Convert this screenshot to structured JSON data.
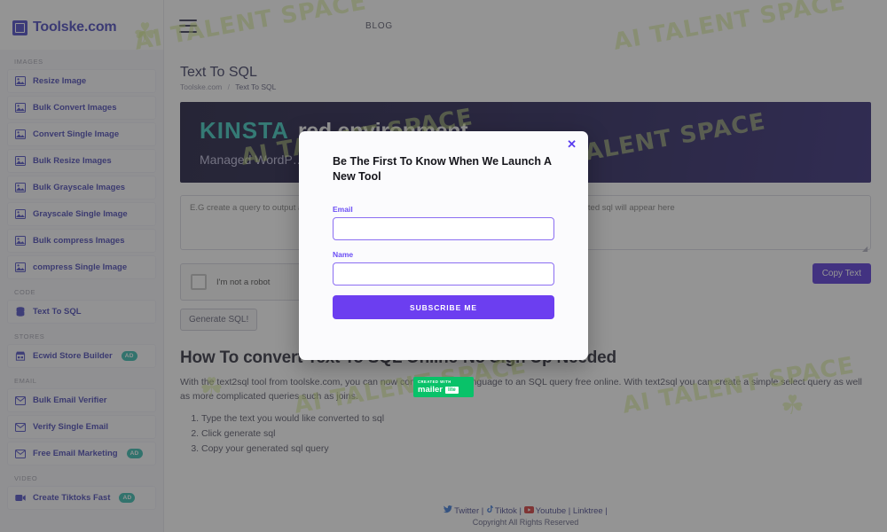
{
  "brand": {
    "name": "Toolske.com",
    "logo_icon": "grid-logo-icon"
  },
  "topnav": {
    "menu_icon": "hamburger-menu-icon",
    "blog_label": "BLOG"
  },
  "sidebar": {
    "groups": [
      {
        "label": "IMAGES",
        "items": [
          {
            "label": "Resize Image",
            "icon": "image-icon",
            "ad": ""
          },
          {
            "label": "Bulk Convert Images",
            "icon": "image-icon",
            "ad": ""
          },
          {
            "label": "Convert Single Image",
            "icon": "image-icon",
            "ad": ""
          },
          {
            "label": "Bulk Resize Images",
            "icon": "image-icon",
            "ad": ""
          },
          {
            "label": "Bulk Grayscale Images",
            "icon": "image-icon",
            "ad": ""
          },
          {
            "label": "Grayscale Single Image",
            "icon": "image-icon",
            "ad": ""
          },
          {
            "label": "Bulk compress Images",
            "icon": "image-icon",
            "ad": ""
          },
          {
            "label": "compress Single Image",
            "icon": "image-icon",
            "ad": ""
          }
        ]
      },
      {
        "label": "CODE",
        "items": [
          {
            "label": "Text To SQL",
            "icon": "database-icon",
            "ad": ""
          }
        ]
      },
      {
        "label": "STORES",
        "items": [
          {
            "label": "Ecwid Store Builder",
            "icon": "store-icon",
            "ad": "AD"
          }
        ]
      },
      {
        "label": "EMAIL",
        "items": [
          {
            "label": "Bulk Email Verifier",
            "icon": "envelope-icon",
            "ad": ""
          },
          {
            "label": "Verify Single Email",
            "icon": "envelope-icon",
            "ad": ""
          },
          {
            "label": "Free Email Marketing",
            "icon": "envelope-icon",
            "ad": "AD"
          }
        ]
      },
      {
        "label": "VIDEO",
        "items": [
          {
            "label": "Create Tiktoks Fast",
            "icon": "video-camera-icon",
            "ad": "AD"
          }
        ]
      }
    ]
  },
  "page": {
    "title": "Text To SQL",
    "breadcrumb_root": "Toolske.com",
    "breadcrumb_sep": "/",
    "breadcrumb_current": "Text To SQL"
  },
  "ad_banner": {
    "brand": "KINSTA",
    "headline_rest": "red environment",
    "subline": "Managed WordP…ncluding a hack-fix guarantee"
  },
  "editor": {
    "input_placeholder": "E.G create a query to output all",
    "output_placeholder": "Your generated sql will appear here",
    "recaptcha_label": "I'm not a robot",
    "generate_label": "Generate SQL!",
    "copy_label": "Copy Text"
  },
  "article": {
    "heading": "How To convert Text To SQL Online-No Sign Up Needed",
    "paragraph": "With the text2sql tool from toolske.com, you can now convert natural language to an SQL query free online. With text2sql you can create a simple select query as well as more complicated queries such as joins.",
    "steps": [
      "Type the text you would like converted to sql",
      "Click generate sql",
      "Copy your generated sql query"
    ]
  },
  "footer": {
    "links": [
      {
        "label": "Twitter",
        "icon": "twitter-icon"
      },
      {
        "label": "Tiktok",
        "icon": "tiktok-icon"
      },
      {
        "label": "Youtube",
        "icon": "youtube-icon"
      },
      {
        "label": "Linktree",
        "icon": "link-icon"
      }
    ],
    "separator": "|",
    "copyright": "Copyright All Rights Reserved"
  },
  "modal": {
    "close_icon": "close-x-icon",
    "title": "Be The First To Know When We Launch A New Tool",
    "email_label": "Email",
    "email_value": "",
    "name_label": "Name",
    "name_value": "",
    "submit_label": "SUBSCRIBE ME"
  },
  "mailerlite_badge": {
    "top": "CREATED WITH",
    "word": "mailer",
    "lite": "lite"
  },
  "watermarks": {
    "texts": [
      "AI TALENT SPACE",
      "AI TALENT SPACE",
      "AI TALENT SPACE",
      "AI TALENT SPACE",
      "AI TALENT SPACE",
      "AI TALENT SPACE"
    ]
  },
  "colors": {
    "accent_purple": "#4b27d4",
    "modal_purple": "#6c3ef0",
    "sidebar_text": "#3b39b0",
    "ad_badge_teal": "#26b5a8",
    "banner_teal": "#2ec6ba",
    "mailerlite_green": "#09c269"
  }
}
